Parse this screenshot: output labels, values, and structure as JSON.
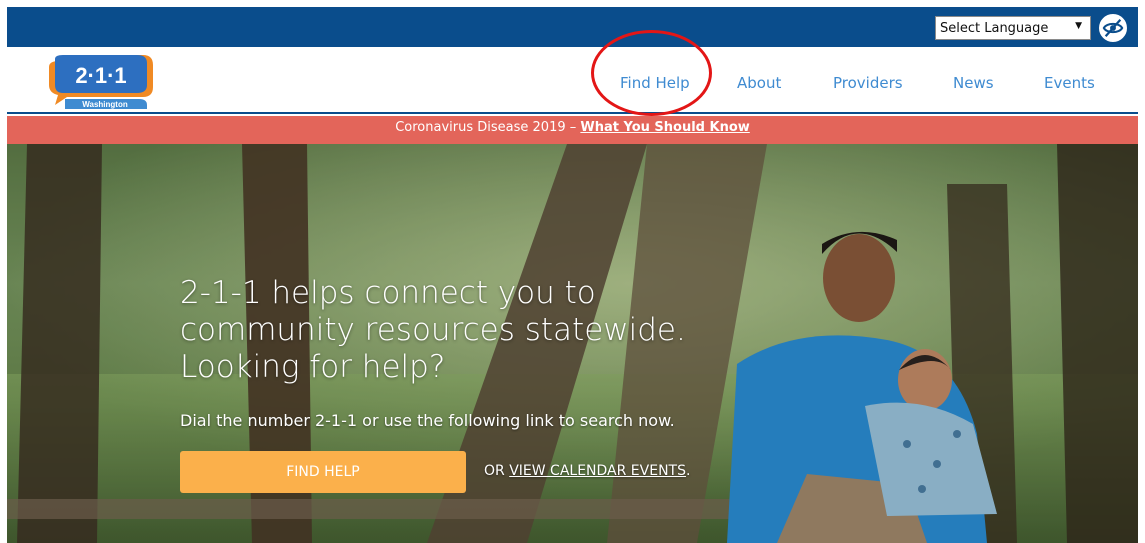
{
  "colors": {
    "utility_bar": "#0a4d8c",
    "nav_link": "#3f8bd1",
    "alert_bar": "#e3655a",
    "cta_button": "#fbb04b",
    "highlight_circle": "#e31616"
  },
  "utility": {
    "language_select": "Select Language",
    "language_arrow": "▼",
    "accessibility_icon": "eye-slash-icon"
  },
  "logo": {
    "numbers": "2·1·1",
    "state": "Washington"
  },
  "nav": {
    "items": [
      {
        "label": "Find Help"
      },
      {
        "label": "About"
      },
      {
        "label": "Providers"
      },
      {
        "label": "News"
      },
      {
        "label": "Events"
      }
    ]
  },
  "alert": {
    "prefix": "Coronavirus Disease 2019 – ",
    "link": "What You Should Know"
  },
  "hero": {
    "title": "2-1-1 helps connect you to community resources statewide. Looking for help?",
    "subtitle": "Dial the number 2-1-1 or use the following link to search now.",
    "button": "FIND HELP",
    "or_prefix": "OR ",
    "or_link": "VIEW CALENDAR EVENTS",
    "or_suffix": "."
  }
}
